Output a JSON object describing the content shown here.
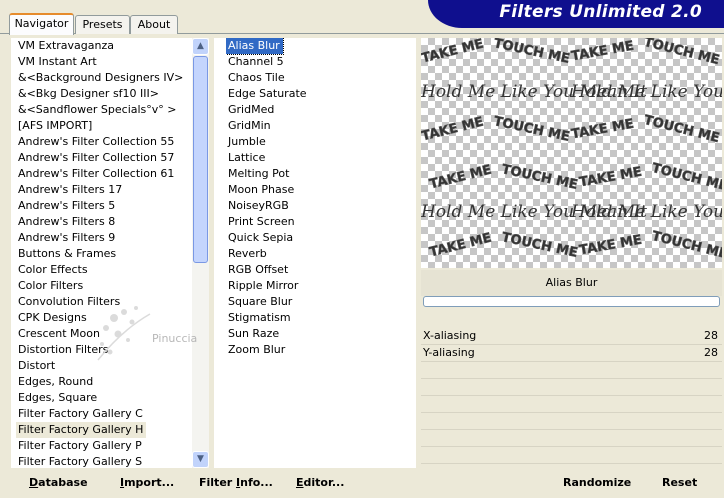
{
  "tabs": [
    {
      "label": "Navigator",
      "active": true
    },
    {
      "label": "Presets",
      "active": false
    },
    {
      "label": "About",
      "active": false
    }
  ],
  "banner": {
    "title": "Filters Unlimited 2.0"
  },
  "categories": {
    "items": [
      "VM Extravaganza",
      "VM Instant Art",
      "&<Background Designers IV>",
      "&<Bkg Designer sf10 III>",
      "&<Sandflower Specials°v° >",
      "[AFS IMPORT]",
      "Andrew's Filter Collection 55",
      "Andrew's Filter Collection 57",
      "Andrew's Filter Collection 61",
      "Andrew's Filters 17",
      "Andrew's Filters 5",
      "Andrew's Filters 8",
      "Andrew's Filters 9",
      "Buttons & Frames",
      "Color Effects",
      "Color Filters",
      "Convolution Filters",
      "CPK Designs",
      "Crescent Moon",
      "Distortion Filters",
      "Distort",
      "Edges, Round",
      "Edges, Square",
      "Filter Factory Gallery C",
      "Filter Factory Gallery H",
      "Filter Factory Gallery P",
      "Filter Factory Gallery S"
    ],
    "selected_index": 24
  },
  "filters": {
    "items": [
      "Alias Blur",
      "Channel 5",
      "Chaos Tile",
      "Edge Saturate",
      "GridMed",
      "GridMin",
      "Jumble",
      "Lattice",
      "Melting Pot",
      "Moon Phase",
      "NoiseyRGB",
      "Print Screen",
      "Quick Sepia",
      "Reverb",
      "RGB Offset",
      "Ripple Mirror",
      "Square Blur",
      "Stigmatism",
      "Sun Raze",
      "Zoom Blur"
    ],
    "selected_index": 0
  },
  "preview": {
    "words_take": "TAKE ME",
    "words_touch": "TOUCH ME",
    "script_line": "Hold Me Like You Mean It"
  },
  "watermark": {
    "text": "Pinuccia"
  },
  "current_filter": {
    "name": "Alias Blur"
  },
  "progress": {
    "value": 0
  },
  "params": [
    {
      "label": "X-aliasing",
      "value": "28"
    },
    {
      "label": "Y-aliasing",
      "value": "28"
    }
  ],
  "buttons": {
    "database_u": "D",
    "database_rest": "atabase",
    "import_u": "I",
    "import_rest": "mport...",
    "filterinfo_u": "Filter ",
    "filterinfo_mid": "I",
    "filterinfo_rest": "nfo...",
    "editor_u": "E",
    "editor_rest": "ditor...",
    "randomize": "Randomize",
    "reset": "Reset"
  },
  "colors": {
    "banner": "#0f0f8e",
    "selection": "#316ac5",
    "tab_accent": "#e68b2c"
  }
}
